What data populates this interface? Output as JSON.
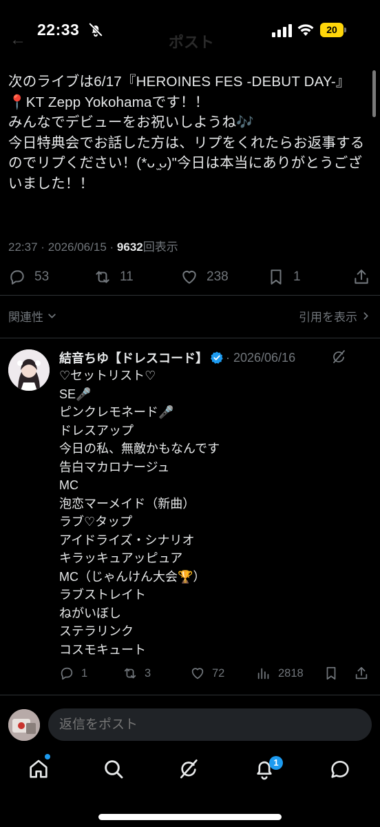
{
  "status_bar": {
    "time": "22:33",
    "battery": "20",
    "back_icon": "back-arrow-icon",
    "header_title": "ポスト"
  },
  "post": {
    "text": "次のライブは6/17『HEROINES FES -DEBUT DAY-』📍KT Zepp Yokohamaです！！\nみんなでデビューをお祝いしようね🎶\n今日特典会でお話した方は、リプをくれたらお返事するのでリプください！(*ᴗ ̫ᴗ)ʺ今日は本当にありがとうございました！！",
    "time": "22:37",
    "date": "2026/06/15",
    "separator": "·",
    "views_count": "9632",
    "views_label": "回表示",
    "reply_count": "53",
    "repost_count": "11",
    "like_count": "238",
    "bookmark_count": "1"
  },
  "sort": {
    "left_label": "関連性",
    "right_label": "引用を表示"
  },
  "reply": {
    "author_name": "結音ちゆ【ドレスコード】",
    "date": "· 2026/06/16",
    "lines": [
      "♡セットリスト♡",
      "SE🎤",
      "ピンクレモネード🎤",
      "ドレスアップ",
      "今日の私、無敵かもなんです",
      "告白マカロナージュ",
      "MC",
      "泡恋マーメイド（新曲）",
      "ラブ♡タップ",
      "アイドライズ・シナリオ",
      "キラッキュアッピュア",
      "MC（じゃんけん大会🏆）",
      "ラブストレイト",
      "ねがいぼし",
      "ステラリンク",
      "コスモキュート"
    ],
    "reply_count": "1",
    "repost_count": "3",
    "like_count": "72",
    "views_count": "2818"
  },
  "composer": {
    "placeholder": "返信をポスト"
  },
  "bottom_nav": {
    "notification_badge": "1",
    "items": [
      "home-icon",
      "search-icon",
      "grok-icon",
      "notifications-icon",
      "messages-icon"
    ]
  },
  "colors": {
    "background": "#000000",
    "text": "#e7e9ea",
    "muted": "#71767b",
    "accent": "#1d9bf0",
    "battery": "#ffd60a"
  }
}
